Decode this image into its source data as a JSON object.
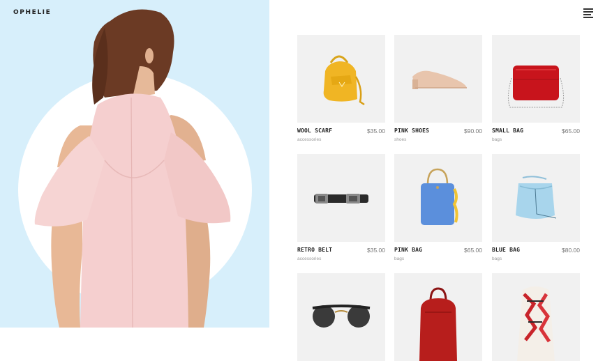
{
  "brand": {
    "logo": "OPHELIE"
  },
  "header": {
    "menu_icon": "hamburger-menu-icon"
  },
  "colors": {
    "hero_background": "#d7effb",
    "card_background": "#f1f1f1",
    "dress": "#f5cfcf"
  },
  "products": [
    {
      "name": "WOOL SCARF",
      "price": "$35.00",
      "category": "accessories",
      "icon": "yellow-backpack-image"
    },
    {
      "name": "PINK SHOES",
      "price": "$90.00",
      "category": "shoes",
      "icon": "beige-mule-shoe-image"
    },
    {
      "name": "SMALL BAG",
      "price": "$65.00",
      "category": "bags",
      "icon": "red-crossbody-bag-image"
    },
    {
      "name": "RETRO BELT",
      "price": "$35.00",
      "category": "accessories",
      "icon": "black-belt-image"
    },
    {
      "name": "PINK BAG",
      "price": "$65.00",
      "category": "bags",
      "icon": "blue-handbag-image"
    },
    {
      "name": "BLUE BAG",
      "price": "$80.00",
      "category": "bags",
      "icon": "light-blue-bucket-bag-image"
    },
    {
      "name": "",
      "price": "",
      "category": "",
      "icon": "sunglasses-image"
    },
    {
      "name": "",
      "price": "",
      "category": "",
      "icon": "red-backpack-image"
    },
    {
      "name": "",
      "price": "",
      "category": "",
      "icon": "printed-scarf-image"
    }
  ]
}
